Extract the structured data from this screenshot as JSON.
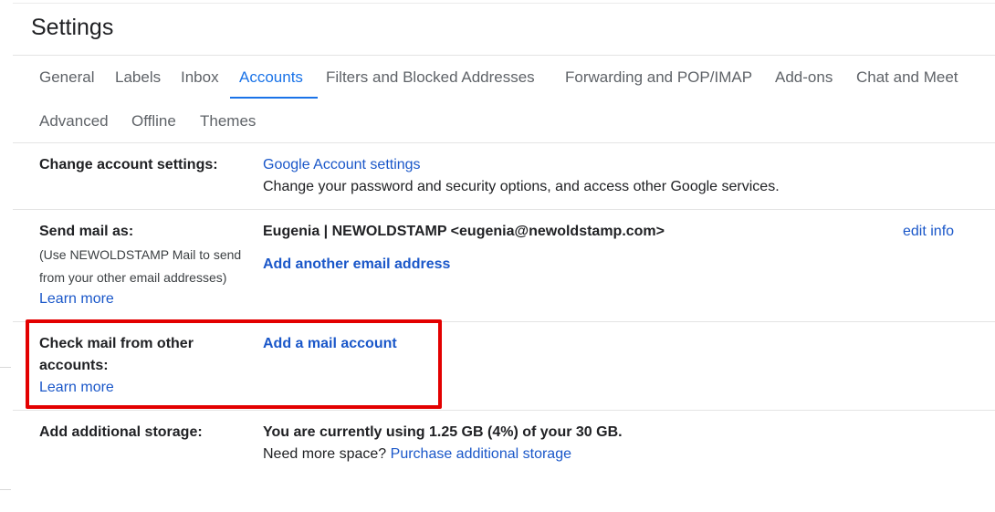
{
  "page_title": "Settings",
  "tabs": [
    {
      "label": "General"
    },
    {
      "label": "Labels"
    },
    {
      "label": "Inbox"
    },
    {
      "label": "Accounts"
    },
    {
      "label": "Filters and Blocked Addresses"
    },
    {
      "label": "Forwarding and POP/IMAP"
    },
    {
      "label": "Add-ons"
    },
    {
      "label": "Chat and Meet"
    },
    {
      "label": "Advanced"
    },
    {
      "label": "Offline"
    },
    {
      "label": "Themes"
    }
  ],
  "active_tab": "Accounts",
  "colors": {
    "accent": "#1a73e8",
    "link": "#1a57c9",
    "highlight": "#e30000"
  },
  "sections": {
    "change_account": {
      "label": "Change account settings:",
      "link": "Google Account settings",
      "desc": "Change your password and security options, and access other Google services."
    },
    "send_mail": {
      "label": "Send mail as:",
      "note_line1": "(Use NEWOLDSTAMP Mail to send",
      "note_line2": "from your other email addresses)",
      "learn_more": "Learn more",
      "address": "Eugenia | NEWOLDSTAMP <eugenia@newoldstamp.com>",
      "edit": "edit info",
      "add_address": "Add another email address"
    },
    "check_mail": {
      "label_line1": "Check mail from other",
      "label_line2": "accounts:",
      "learn_more": "Learn more",
      "add_account": "Add a mail account"
    },
    "storage": {
      "label": "Add additional storage:",
      "usage": "You are currently using 1.25 GB (4%) of your 30 GB.",
      "need_more": "Need more space?",
      "purchase": "Purchase additional storage"
    }
  }
}
